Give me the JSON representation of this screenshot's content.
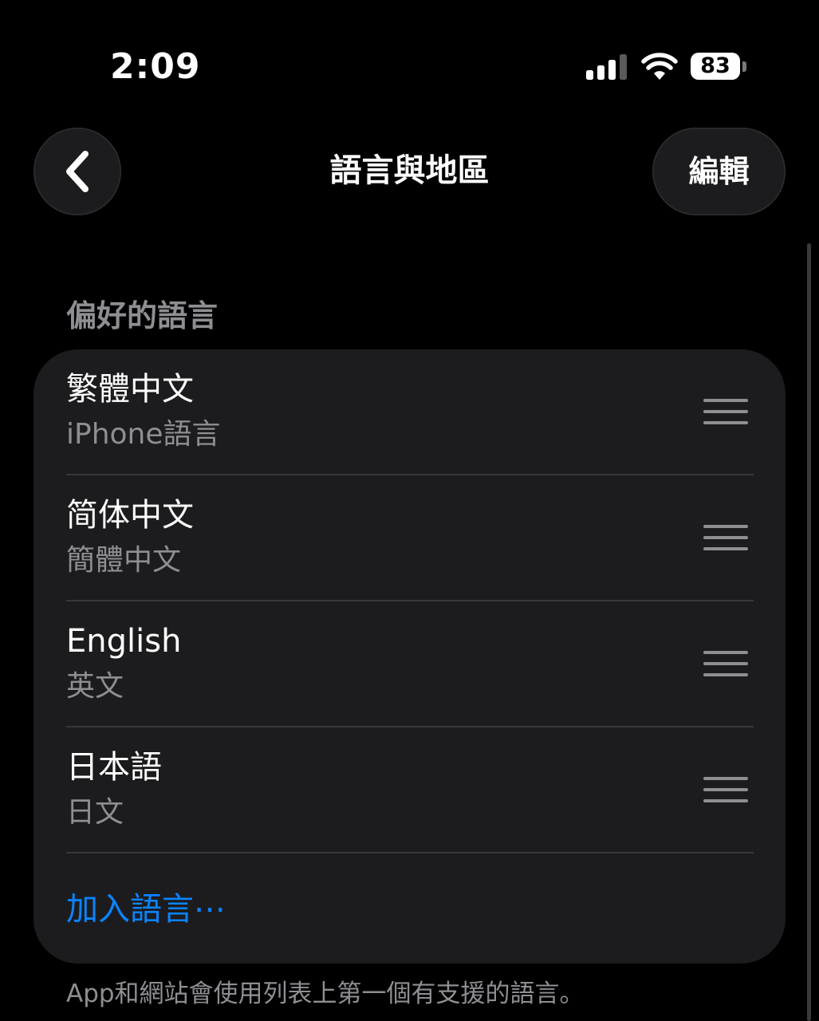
{
  "status_bar": {
    "time": "2:09",
    "battery_level": "83",
    "signal_icon": "cellular-signal-icon",
    "wifi_icon": "wifi-icon",
    "battery_icon": "battery-icon"
  },
  "nav": {
    "back_icon": "chevron-left-icon",
    "title": "語言與地區",
    "edit_label": "編輯"
  },
  "section": {
    "header": "偏好的語言"
  },
  "languages": [
    {
      "name": "繁體中文",
      "subtitle": "iPhone語言"
    },
    {
      "name": "简体中文",
      "subtitle": "簡體中文"
    },
    {
      "name": "English",
      "subtitle": "英文"
    },
    {
      "name": "日本語",
      "subtitle": "日文"
    }
  ],
  "add_language_label": "加入語言⋯",
  "footer_note": "App和網站會使用列表上第一個有支援的語言。",
  "colors": {
    "background": "#000000",
    "card": "#1c1c1e",
    "secondary_text": "#8e8e93",
    "accent": "#0a84ff"
  }
}
